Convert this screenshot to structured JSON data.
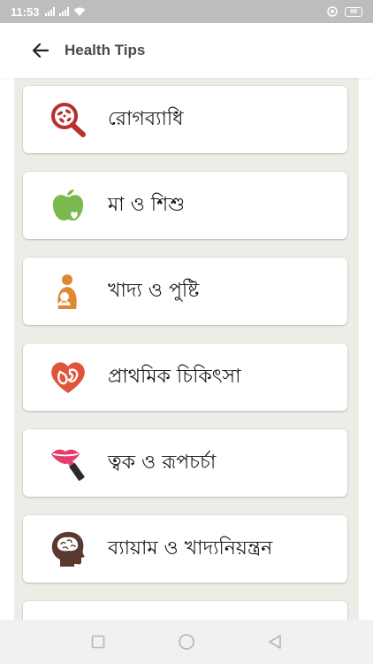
{
  "status_bar": {
    "time": "11:53",
    "battery": "88"
  },
  "app_bar": {
    "title": "Health Tips",
    "back_icon": "arrow-back-icon"
  },
  "categories": [
    {
      "label": "রোগব্যাধি",
      "icon": "disease-magnifier-icon"
    },
    {
      "label": "মা ও শিশু",
      "icon": "apple-heart-icon"
    },
    {
      "label": "খাদ্য ও পুষ্টি",
      "icon": "mother-child-icon"
    },
    {
      "label": "প্রাথমিক চিকিৎসা",
      "icon": "heart-firstaid-icon"
    },
    {
      "label": "ত্বক ও রূপচর্চা",
      "icon": "lips-lipstick-icon"
    },
    {
      "label": "ব্যায়াম ও খাদ্যনিয়ন্ত্রন",
      "icon": "brain-head-icon"
    },
    {
      "label": "",
      "icon": "partial-icon"
    }
  ],
  "colors": {
    "status_bar": "#bdbdbd",
    "panel_bg": "#edece6",
    "disease_red": "#b82f2f",
    "apple_green": "#79b94e",
    "mother_orange": "#e0882f",
    "heart_red": "#e0543a",
    "lips_pink": "#e33d6b",
    "brain_brown": "#5a3a30"
  }
}
